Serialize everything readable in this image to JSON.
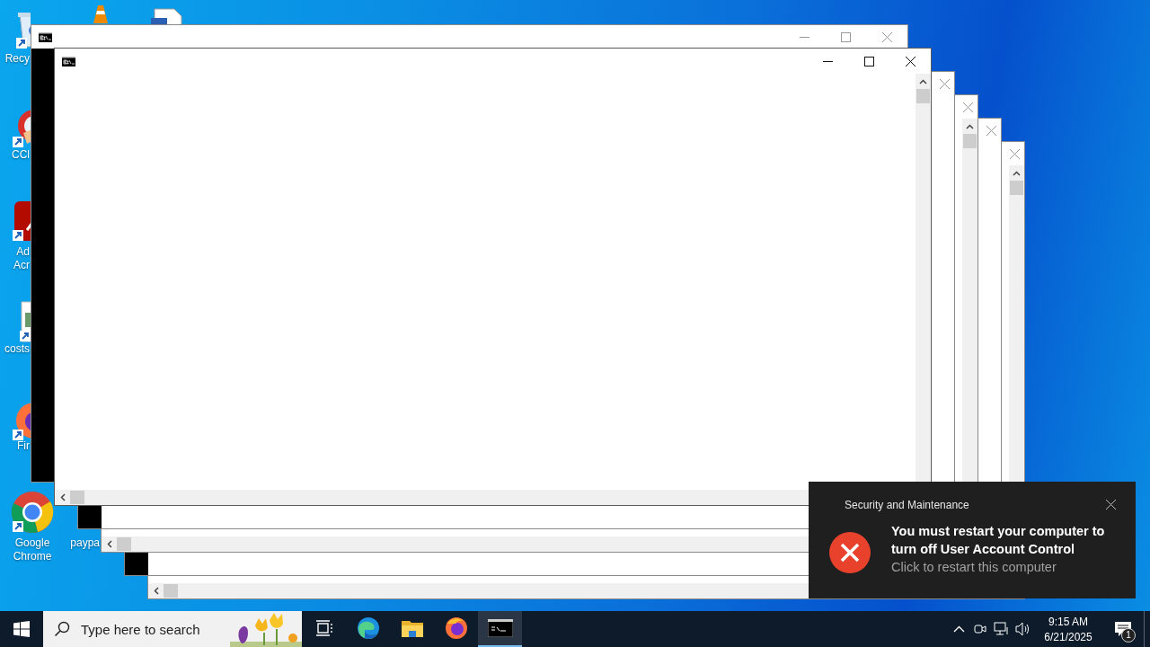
{
  "desktop_icons": [
    {
      "lines": [
        "Recy"
      ]
    },
    {
      "lines": [
        "CCl"
      ]
    },
    {
      "lines": [
        "Ad",
        "Acr"
      ]
    },
    {
      "lines": [
        "costs"
      ]
    },
    {
      "lines": [
        "Fir"
      ]
    },
    {
      "lines": [
        "Google",
        "Chrome"
      ]
    },
    {
      "lines": [
        "paypa"
      ]
    }
  ],
  "windows": [
    {
      "kind": "dark",
      "focused": false
    },
    {
      "kind": "light",
      "focused": false
    },
    {
      "kind": "dark",
      "focused": false
    },
    {
      "kind": "light",
      "focused": false
    },
    {
      "kind": "dark",
      "focused": false
    },
    {
      "kind": "light",
      "focused": true
    }
  ],
  "notification": {
    "source": "Security and Maintenance",
    "title": "You must restart your computer to turn off User Account Control",
    "body": "Click to restart this computer"
  },
  "taskbar": {
    "search": {
      "placeholder": "Type here to search"
    },
    "apps": [
      {
        "kind": "taskview",
        "running": false
      },
      {
        "kind": "edge",
        "running": false
      },
      {
        "kind": "explorer",
        "running": false
      },
      {
        "kind": "firefox",
        "running": false
      },
      {
        "kind": "console",
        "running": true
      }
    ],
    "clock": {
      "time": "9:15 AM",
      "date": "6/21/2025"
    },
    "notification_count": "1"
  }
}
